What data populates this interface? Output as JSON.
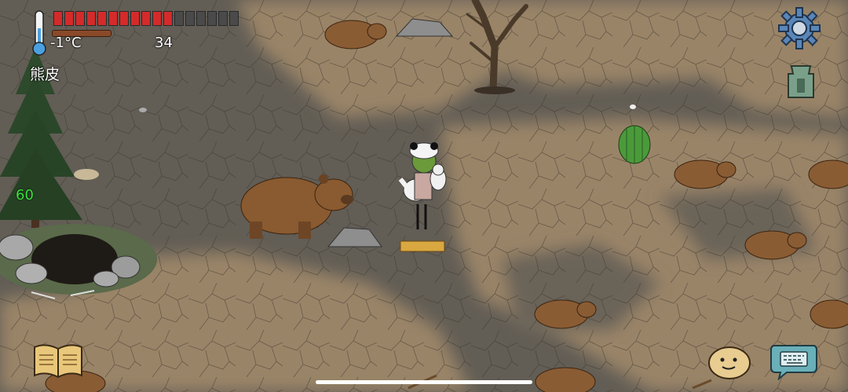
{
  "hud": {
    "temperature": "-1°C",
    "food_count": "34",
    "held_item": "熊皮",
    "age": "60",
    "food_pips_filled": 11,
    "food_pips_total": 17
  },
  "icons": {
    "settings": "gear-icon",
    "tech_tree": "tech-tree-icon",
    "recipe_book": "book-icon",
    "emote": "face-icon",
    "chat": "keyboard-icon"
  },
  "colors": {
    "food_full": "#d52a2a",
    "food_empty": "#4a4a4a",
    "age_text": "#3be03b",
    "ground_dark": "#5f5a52",
    "ground_light": "#9a8468"
  }
}
